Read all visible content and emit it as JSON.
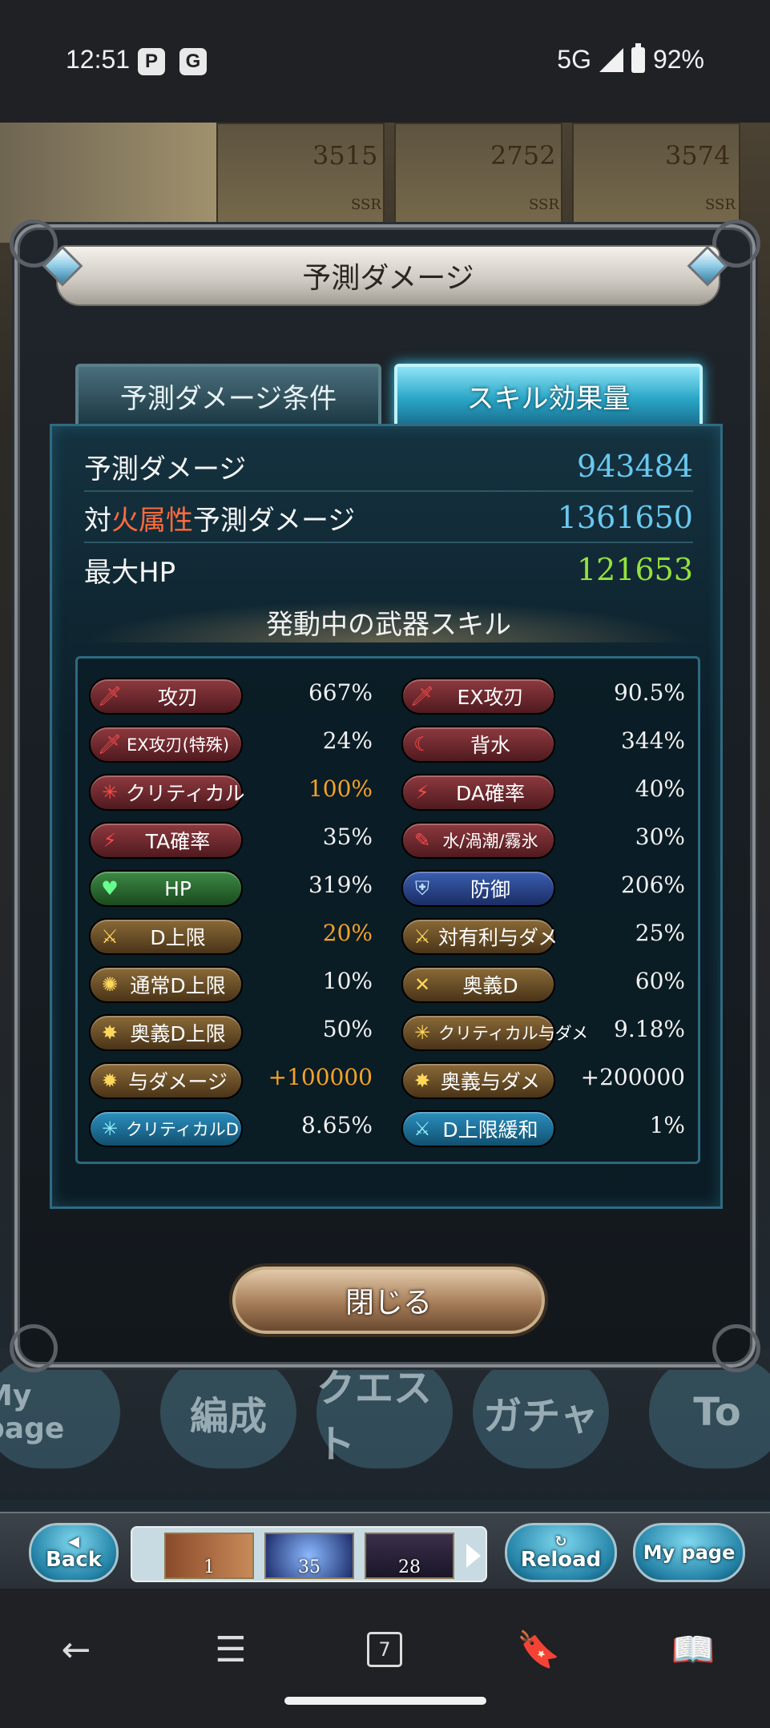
{
  "status_bar": {
    "time": "12:51",
    "app_icons": [
      "P",
      "G"
    ],
    "network": "5G",
    "battery": "92%"
  },
  "background": {
    "stats": [
      "3515",
      "2752",
      "3574"
    ],
    "rarity": [
      "SSR",
      "SSR",
      "SSR"
    ],
    "nav_buttons": [
      "My page",
      "編成",
      "クエスト",
      "ガチャ",
      "To"
    ]
  },
  "modal": {
    "title": "予測ダメージ",
    "tabs": {
      "conditions": "予測ダメージ条件",
      "skills": "スキル効果量"
    },
    "summary": {
      "predicted_damage_label": "予測ダメージ",
      "predicted_damage_value": "943484",
      "vs_prefix": "対",
      "vs_element": "火属性",
      "vs_suffix": "予測ダメージ",
      "vs_element_damage_value": "1361650",
      "max_hp_label": "最大HP",
      "max_hp_value": "121653"
    },
    "skills_heading": "発動中の武器スキル",
    "skills": [
      {
        "left": {
          "label": "攻刃",
          "value": "667%",
          "style": "red",
          "icon": "sword-icon",
          "glyph": "🗡"
        },
        "right": {
          "label": "EX攻刃",
          "value": "90.5%",
          "style": "red",
          "icon": "sword-icon",
          "glyph": "🗡"
        }
      },
      {
        "left": {
          "label": "EX攻刃(特殊)",
          "value": "24%",
          "style": "red",
          "icon": "sword-icon",
          "glyph": "🗡"
        },
        "right": {
          "label": "背水",
          "value": "344%",
          "style": "red",
          "icon": "crescent-icon",
          "glyph": "☾"
        }
      },
      {
        "left": {
          "label": "クリティカル",
          "value": "100%",
          "value_color": "orange",
          "style": "red",
          "icon": "burst-icon",
          "glyph": "✳"
        },
        "right": {
          "label": "DA確率",
          "value": "40%",
          "style": "red",
          "icon": "double-strike-icon",
          "glyph": "⚡"
        }
      },
      {
        "left": {
          "label": "TA確率",
          "value": "35%",
          "style": "red",
          "icon": "triple-strike-icon",
          "glyph": "⚡"
        },
        "right": {
          "label": "水/渦潮/霧氷",
          "value": "30%",
          "style": "red",
          "icon": "feather-icon",
          "glyph": "✎"
        }
      },
      {
        "left": {
          "label": "HP",
          "value": "319%",
          "style": "green",
          "icon": "heart-icon",
          "glyph": "♥"
        },
        "right": {
          "label": "防御",
          "value": "206%",
          "style": "blue",
          "icon": "shield-icon",
          "glyph": "⛨"
        }
      },
      {
        "left": {
          "label": "D上限",
          "value": "20%",
          "value_color": "orange",
          "style": "gold",
          "icon": "sword-up-icon",
          "glyph": "⚔"
        },
        "right": {
          "label": "対有利与ダメ",
          "value": "25%",
          "style": "gold",
          "icon": "crossed-swords-icon",
          "glyph": "⚔"
        }
      },
      {
        "left": {
          "label": "通常D上限",
          "value": "10%",
          "style": "gold",
          "icon": "sunburst-icon",
          "glyph": "✺"
        },
        "right": {
          "label": "奥義D",
          "value": "60%",
          "style": "gold",
          "icon": "cross-icon",
          "glyph": "✕"
        }
      },
      {
        "left": {
          "label": "奥義D上限",
          "value": "50%",
          "style": "gold",
          "icon": "star-burst-icon",
          "glyph": "✸"
        },
        "right": {
          "label": "クリティカル与ダメ",
          "value": "9.18%",
          "style": "gold",
          "icon": "sparkle-icon",
          "glyph": "✳"
        }
      },
      {
        "left": {
          "label": "与ダメージ",
          "value": "+100000",
          "value_color": "orange",
          "style": "gold",
          "icon": "sun-icon",
          "glyph": "✹"
        },
        "right": {
          "label": "奥義与ダメ",
          "value": "+200000",
          "style": "gold",
          "icon": "star-burst-icon",
          "glyph": "✸"
        }
      },
      {
        "left": {
          "label": "クリティカルD",
          "value": "8.65%",
          "style": "cyan",
          "icon": "sparkle-icon",
          "glyph": "✳"
        },
        "right": {
          "label": "D上限緩和",
          "value": "1%",
          "style": "cyan",
          "icon": "sword-up-icon",
          "glyph": "⚔"
        }
      }
    ],
    "close_label": "閉じる"
  },
  "bottom_bar": {
    "back_label": "Back",
    "reload_label": "Reload",
    "mypage_label": "My page",
    "tab_counts": [
      "1",
      "35",
      "28"
    ]
  },
  "android_nav": {
    "tab_count": "7"
  }
}
